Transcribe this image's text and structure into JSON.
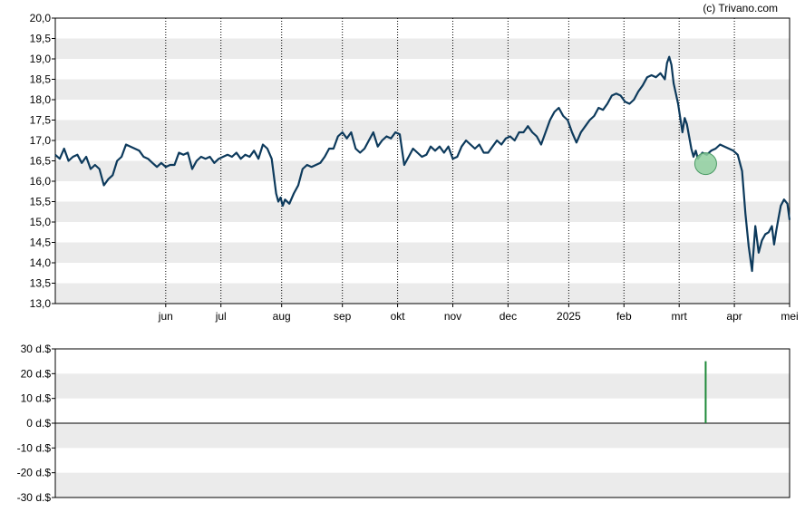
{
  "copyright": "(c) Trivano.com",
  "colors": {
    "line": "#0d3a5c",
    "band": "#ebebeb",
    "marker_fill": "#8fcf9f",
    "marker_stroke": "#4a9a64",
    "volume_bar": "#1f8a3a"
  },
  "chart_data": [
    {
      "type": "line",
      "title": "",
      "ylim": [
        13.0,
        20.0
      ],
      "y_ticks": [
        "13,0",
        "13,5",
        "14,0",
        "14,5",
        "15,0",
        "15,5",
        "16,0",
        "16,5",
        "17,0",
        "17,5",
        "18,0",
        "18,5",
        "19,0",
        "19,5",
        "20,0"
      ],
      "x_ticks": [
        {
          "label": "jun",
          "x": 1.0
        },
        {
          "label": "jul",
          "x": 2.0
        },
        {
          "label": "aug",
          "x": 3.1
        },
        {
          "label": "sep",
          "x": 4.2
        },
        {
          "label": "okt",
          "x": 5.2
        },
        {
          "label": "nov",
          "x": 6.2
        },
        {
          "label": "dec",
          "x": 7.2
        },
        {
          "label": "2025",
          "x": 8.3
        },
        {
          "label": "feb",
          "x": 9.3
        },
        {
          "label": "mrt",
          "x": 10.3
        },
        {
          "label": "apr",
          "x": 11.3
        },
        {
          "label": "mei",
          "x": 12.3
        }
      ],
      "xlim": [
        -1.0,
        12.3
      ],
      "grid": "dotted vertical at month ticks, alternating horizontal bands",
      "series": [
        {
          "points": [
            [
              -1.0,
              16.65
            ],
            [
              -0.92,
              16.55
            ],
            [
              -0.84,
              16.8
            ],
            [
              -0.76,
              16.5
            ],
            [
              -0.68,
              16.6
            ],
            [
              -0.6,
              16.65
            ],
            [
              -0.52,
              16.45
            ],
            [
              -0.44,
              16.6
            ],
            [
              -0.36,
              16.3
            ],
            [
              -0.28,
              16.4
            ],
            [
              -0.2,
              16.3
            ],
            [
              -0.12,
              15.9
            ],
            [
              -0.04,
              16.05
            ],
            [
              0.04,
              16.15
            ],
            [
              0.12,
              16.5
            ],
            [
              0.2,
              16.6
            ],
            [
              0.28,
              16.9
            ],
            [
              0.36,
              16.85
            ],
            [
              0.44,
              16.8
            ],
            [
              0.52,
              16.75
            ],
            [
              0.6,
              16.6
            ],
            [
              0.68,
              16.55
            ],
            [
              0.76,
              16.45
            ],
            [
              0.84,
              16.35
            ],
            [
              0.92,
              16.45
            ],
            [
              1.0,
              16.35
            ],
            [
              1.08,
              16.4
            ],
            [
              1.16,
              16.4
            ],
            [
              1.24,
              16.7
            ],
            [
              1.32,
              16.65
            ],
            [
              1.4,
              16.7
            ],
            [
              1.48,
              16.3
            ],
            [
              1.56,
              16.5
            ],
            [
              1.64,
              16.6
            ],
            [
              1.72,
              16.55
            ],
            [
              1.8,
              16.6
            ],
            [
              1.88,
              16.45
            ],
            [
              1.96,
              16.55
            ],
            [
              2.04,
              16.6
            ],
            [
              2.12,
              16.65
            ],
            [
              2.2,
              16.6
            ],
            [
              2.28,
              16.7
            ],
            [
              2.36,
              16.55
            ],
            [
              2.44,
              16.65
            ],
            [
              2.52,
              16.6
            ],
            [
              2.6,
              16.75
            ],
            [
              2.68,
              16.55
            ],
            [
              2.76,
              16.9
            ],
            [
              2.84,
              16.8
            ],
            [
              2.92,
              16.55
            ],
            [
              3.0,
              15.7
            ],
            [
              3.04,
              15.5
            ],
            [
              3.08,
              15.6
            ],
            [
              3.12,
              15.4
            ],
            [
              3.16,
              15.55
            ],
            [
              3.24,
              15.45
            ],
            [
              3.32,
              15.7
            ],
            [
              3.4,
              15.9
            ],
            [
              3.48,
              16.3
            ],
            [
              3.56,
              16.4
            ],
            [
              3.64,
              16.35
            ],
            [
              3.72,
              16.4
            ],
            [
              3.8,
              16.45
            ],
            [
              3.88,
              16.6
            ],
            [
              3.96,
              16.8
            ],
            [
              4.04,
              16.8
            ],
            [
              4.12,
              17.1
            ],
            [
              4.2,
              17.2
            ],
            [
              4.28,
              17.05
            ],
            [
              4.36,
              17.2
            ],
            [
              4.44,
              16.8
            ],
            [
              4.52,
              16.7
            ],
            [
              4.6,
              16.8
            ],
            [
              4.68,
              17.0
            ],
            [
              4.76,
              17.2
            ],
            [
              4.84,
              16.85
            ],
            [
              4.92,
              17.0
            ],
            [
              5.0,
              17.1
            ],
            [
              5.08,
              17.05
            ],
            [
              5.16,
              17.2
            ],
            [
              5.24,
              17.15
            ],
            [
              5.32,
              16.4
            ],
            [
              5.4,
              16.6
            ],
            [
              5.48,
              16.8
            ],
            [
              5.56,
              16.7
            ],
            [
              5.64,
              16.6
            ],
            [
              5.72,
              16.65
            ],
            [
              5.8,
              16.85
            ],
            [
              5.88,
              16.75
            ],
            [
              5.96,
              16.85
            ],
            [
              6.04,
              16.7
            ],
            [
              6.12,
              16.85
            ],
            [
              6.2,
              16.55
            ],
            [
              6.28,
              16.6
            ],
            [
              6.36,
              16.85
            ],
            [
              6.44,
              17.0
            ],
            [
              6.52,
              16.9
            ],
            [
              6.6,
              16.8
            ],
            [
              6.68,
              16.9
            ],
            [
              6.76,
              16.7
            ],
            [
              6.84,
              16.7
            ],
            [
              6.92,
              16.85
            ],
            [
              7.0,
              17.0
            ],
            [
              7.08,
              16.9
            ],
            [
              7.16,
              17.05
            ],
            [
              7.24,
              17.1
            ],
            [
              7.32,
              17.0
            ],
            [
              7.4,
              17.2
            ],
            [
              7.48,
              17.2
            ],
            [
              7.56,
              17.35
            ],
            [
              7.64,
              17.2
            ],
            [
              7.72,
              17.1
            ],
            [
              7.8,
              16.9
            ],
            [
              7.88,
              17.2
            ],
            [
              7.96,
              17.5
            ],
            [
              8.04,
              17.7
            ],
            [
              8.12,
              17.8
            ],
            [
              8.2,
              17.6
            ],
            [
              8.28,
              17.5
            ],
            [
              8.36,
              17.2
            ],
            [
              8.44,
              16.95
            ],
            [
              8.52,
              17.2
            ],
            [
              8.6,
              17.35
            ],
            [
              8.68,
              17.5
            ],
            [
              8.76,
              17.6
            ],
            [
              8.84,
              17.8
            ],
            [
              8.92,
              17.75
            ],
            [
              9.0,
              17.9
            ],
            [
              9.08,
              18.1
            ],
            [
              9.16,
              18.15
            ],
            [
              9.24,
              18.1
            ],
            [
              9.32,
              17.95
            ],
            [
              9.4,
              17.9
            ],
            [
              9.48,
              18.0
            ],
            [
              9.56,
              18.2
            ],
            [
              9.64,
              18.35
            ],
            [
              9.72,
              18.55
            ],
            [
              9.8,
              18.6
            ],
            [
              9.88,
              18.55
            ],
            [
              9.96,
              18.65
            ],
            [
              10.04,
              18.5
            ],
            [
              10.08,
              18.9
            ],
            [
              10.12,
              19.05
            ],
            [
              10.16,
              18.85
            ],
            [
              10.2,
              18.4
            ],
            [
              10.28,
              17.9
            ],
            [
              10.36,
              17.2
            ],
            [
              10.4,
              17.55
            ],
            [
              10.44,
              17.4
            ],
            [
              10.52,
              16.8
            ],
            [
              10.56,
              16.6
            ],
            [
              10.6,
              16.75
            ],
            [
              10.64,
              16.55
            ],
            [
              10.72,
              16.7
            ],
            [
              10.8,
              16.65
            ],
            [
              10.88,
              16.75
            ],
            [
              10.96,
              16.8
            ],
            [
              11.04,
              16.9
            ],
            [
              11.12,
              16.85
            ],
            [
              11.2,
              16.8
            ],
            [
              11.28,
              16.75
            ],
            [
              11.36,
              16.65
            ],
            [
              11.44,
              16.25
            ],
            [
              11.5,
              15.2
            ],
            [
              11.56,
              14.4
            ],
            [
              11.62,
              13.8
            ],
            [
              11.68,
              14.9
            ],
            [
              11.74,
              14.25
            ],
            [
              11.8,
              14.55
            ],
            [
              11.86,
              14.7
            ],
            [
              11.92,
              14.75
            ],
            [
              11.98,
              14.9
            ],
            [
              12.02,
              14.45
            ],
            [
              12.06,
              14.8
            ],
            [
              12.1,
              15.1
            ],
            [
              12.14,
              15.4
            ],
            [
              12.2,
              15.55
            ],
            [
              12.26,
              15.45
            ],
            [
              12.3,
              15.05
            ]
          ]
        }
      ],
      "marker": {
        "x": 10.78,
        "y": 16.43
      }
    },
    {
      "type": "bar",
      "title": "",
      "ylim": [
        -30,
        30
      ],
      "y_ticks": [
        "30 d.$",
        "20 d.$",
        "10 d.$",
        "0 d.$",
        "-10 d.$",
        "-20 d.$",
        "-30 d.$"
      ],
      "series": [
        {
          "points": [
            [
              10.78,
              25
            ]
          ]
        }
      ]
    }
  ]
}
